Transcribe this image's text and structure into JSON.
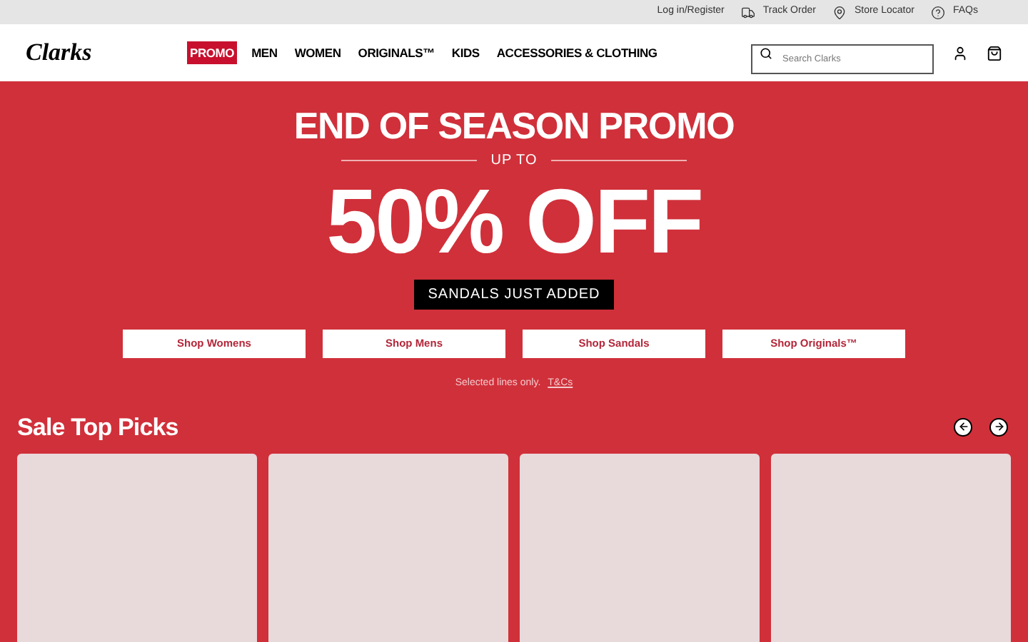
{
  "utility_bar": {
    "links": [
      {
        "label": "Log in/Register"
      },
      {
        "label": "Track Order"
      },
      {
        "label": "Store Locator"
      },
      {
        "label": "FAQs"
      }
    ]
  },
  "header": {
    "logo": "Clarks",
    "nav": [
      {
        "label": "PROMO",
        "selected": true
      },
      {
        "label": "MEN",
        "selected": false
      },
      {
        "label": "WOMEN",
        "selected": false
      },
      {
        "label": "ORIGINALS™",
        "selected": false
      },
      {
        "label": "KIDS",
        "selected": false
      },
      {
        "label": "ACCESSORIES & CLOTHING",
        "selected": false
      }
    ],
    "search": {
      "placeholder": "Search Clarks"
    }
  },
  "hero": {
    "title": "END OF SEASON PROMO",
    "subtitle": "UP TO",
    "headline": "50% OFF",
    "tag": "SANDALS JUST ADDED",
    "buttons": [
      "Shop Womens",
      "Shop Mens",
      "Shop Sandals",
      "Shop Originals™"
    ],
    "note": "Selected lines only.",
    "terms_link": "T&Cs"
  },
  "picks": {
    "title": "Sale Top Picks",
    "cards": [
      {
        "kind": "empty"
      },
      {
        "kind": "empty"
      },
      {
        "kind": "empty"
      },
      {
        "kind": "empty"
      }
    ]
  }
}
